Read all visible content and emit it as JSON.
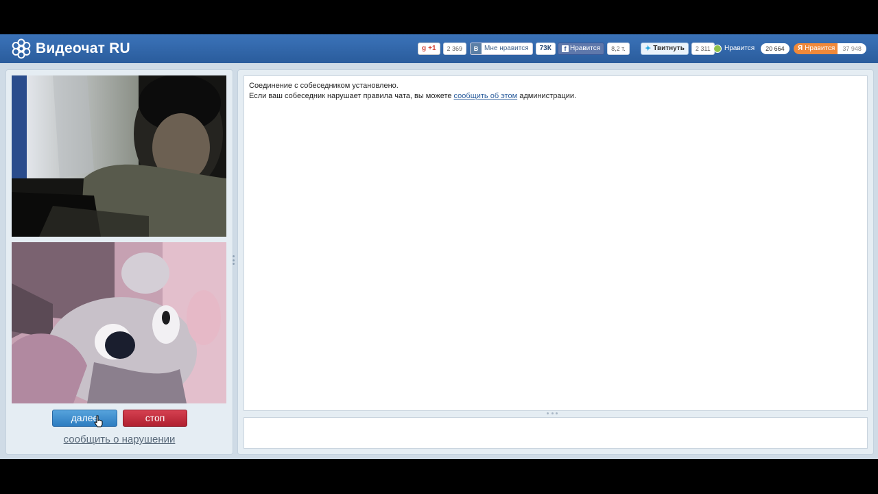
{
  "header": {
    "logo_text": "Видеочат RU",
    "logo_icon": "flower-logo-icon",
    "social": {
      "google_label": "+1",
      "google_count": "2 369",
      "vk_logo": "В",
      "vk_label": "Мне нравится",
      "vk_count": "73К",
      "fb_logo": "f",
      "fb_label": "Нравится",
      "fb_count": "8,2 т.",
      "tw_label": "Твитнуть",
      "tw_count": "2 311",
      "ok_label": "Нравится",
      "ok_count": "20 664",
      "ya_label": "Нравится",
      "ya_count": "37 948"
    }
  },
  "video": {
    "remote_label": "remote-video",
    "local_label": "local-video"
  },
  "controls": {
    "next_label": "далее",
    "stop_label": "стоп",
    "report_label": "сообщить о нарушении"
  },
  "chat": {
    "line1": "Соединение с собеседником установлено.",
    "line2_before": "Если ваш собеседник нарушает правила чата, вы можете ",
    "line2_link": "сообщить об этом",
    "line2_after": " администрации.",
    "input_value": ""
  },
  "colors": {
    "header": "#3b73b9",
    "next_button": "#3d8bd0",
    "stop_button": "#c42d3c",
    "panel": "#e5edf3"
  }
}
